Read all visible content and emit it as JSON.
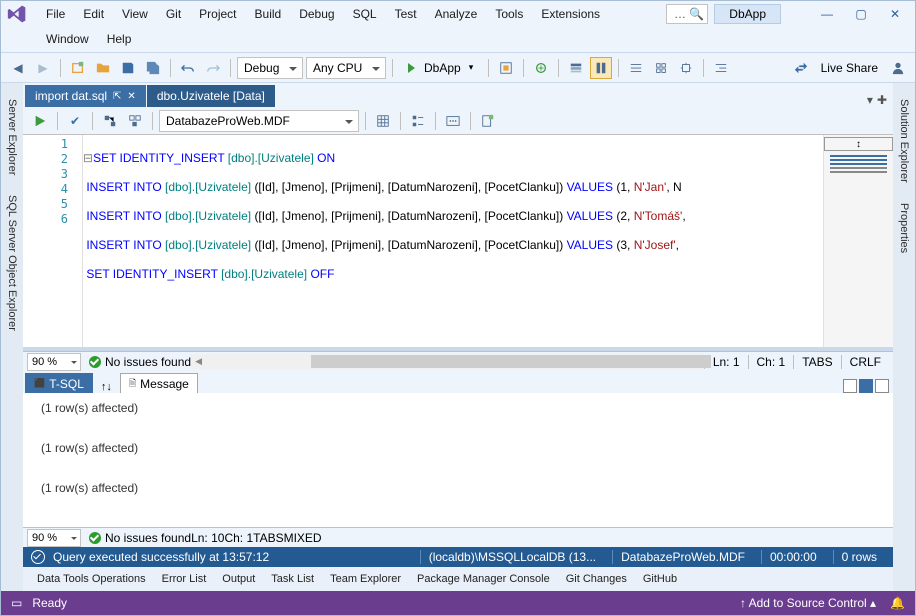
{
  "menu": {
    "file": "File",
    "edit": "Edit",
    "view": "View",
    "git": "Git",
    "project": "Project",
    "build": "Build",
    "debug": "Debug",
    "sql": "SQL",
    "test": "Test",
    "analyze": "Analyze",
    "tools": "Tools",
    "extensions": "Extensions",
    "window": "Window",
    "help": "Help"
  },
  "app_name": "DbApp",
  "config": "Debug",
  "platform": "Any CPU",
  "launch_target": "DbApp",
  "live_share": "Live Share",
  "side": {
    "server_explorer": "Server Explorer",
    "sql_object": "SQL Server Object Explorer",
    "solution": "Solution Explorer",
    "properties": "Properties"
  },
  "tabs": {
    "active": "import dat.sql",
    "preview": "dbo.Uzivatele [Data]"
  },
  "db_combo": "DatabazeProWeb.MDF",
  "code": {
    "l1_a": "SET IDENTITY_INSERT",
    "l1_b": "[dbo].[Uzivatele]",
    "l1_c": "ON",
    "ins": "INSERT INTO",
    "tbl": "[dbo].[Uzivatele]",
    "cols": "([Id], [Jmeno], [Prijmeni], [DatumNarozeni], [PocetClanku])",
    "vals": "VALUES",
    "v1": "(1, ",
    "s1": "N'Jan'",
    "tail": ", N",
    "v2": "(2, ",
    "s2": "N'Tomáš'",
    "tail2": ",",
    "v3": "(3, ",
    "s3": "N'Josef'",
    "tail3": ",",
    "off": "OFF"
  },
  "line_numbers": [
    "1",
    "2",
    "3",
    "4",
    "5",
    "6"
  ],
  "editor_status": {
    "zoom": "90 %",
    "issues": "No issues found",
    "ln": "Ln: 1",
    "ch": "Ch: 1",
    "tabs": "TABS",
    "eol": "CRLF"
  },
  "result_tabs": {
    "tsql": "T-SQL",
    "message": "Message",
    "arrows": "↑↓"
  },
  "messages": [
    "(1 row(s) affected)",
    "(1 row(s) affected)",
    "(1 row(s) affected)"
  ],
  "lower_status": {
    "zoom": "90 %",
    "issues": "No issues found",
    "ln": "Ln: 10",
    "ch": "Ch: 1",
    "tabs": "TABS",
    "eol": "MIXED"
  },
  "exec": {
    "text": "Query executed successfully at 13:57:12",
    "conn": "(localdb)\\MSSQLLocalDB (13...",
    "db": "DatabazeProWeb.MDF",
    "time": "00:00:00",
    "rows": "0 rows"
  },
  "bottom": {
    "data_tools": "Data Tools Operations",
    "error_list": "Error List",
    "output": "Output",
    "task_list": "Task List",
    "team": "Team Explorer",
    "pkg": "Package Manager Console",
    "gitchg": "Git Changes",
    "github": "GitHub"
  },
  "status": {
    "ready": "Ready",
    "src": "Add to Source Control"
  }
}
